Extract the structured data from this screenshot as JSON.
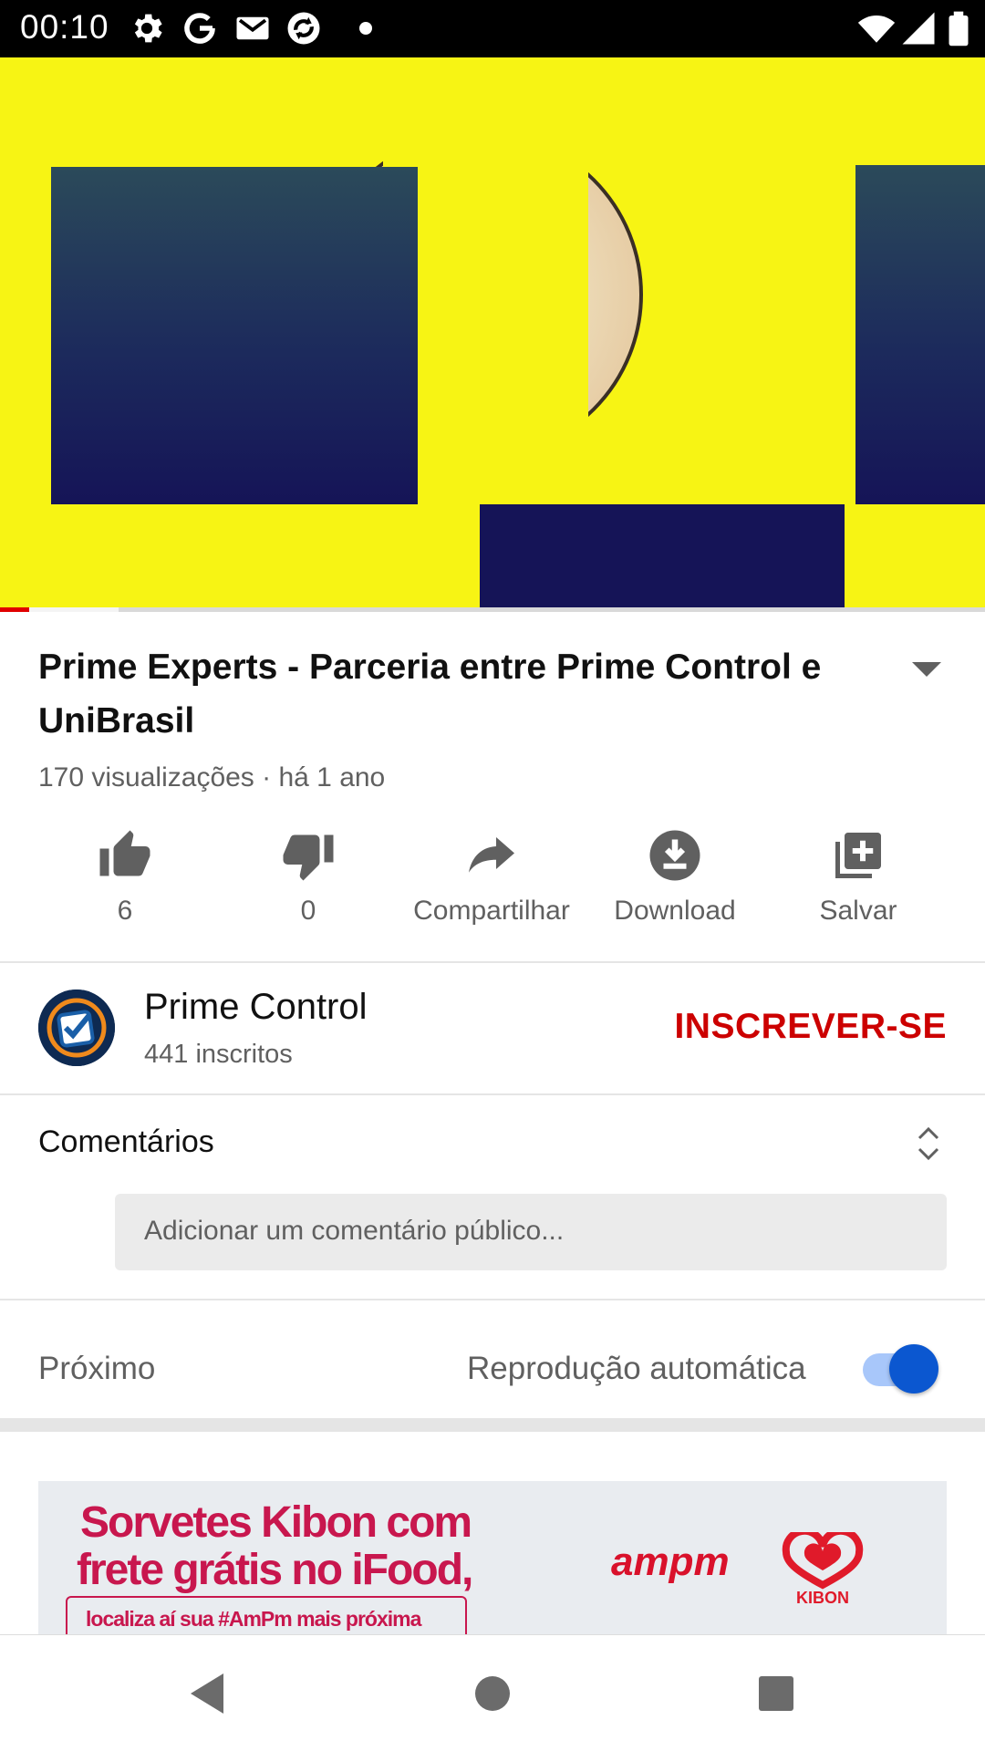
{
  "status_bar": {
    "time": "00:10",
    "icons": [
      "gear-icon",
      "google-icon",
      "gmail-icon",
      "sync-icon",
      "dot-icon",
      "wifi-icon",
      "signal-icon",
      "battery-icon"
    ]
  },
  "video": {
    "progress_fraction": 0.03,
    "buffer_fraction": 0.12
  },
  "details": {
    "title": "Prime Experts - Parceria entre Prime Control e UniBrasil",
    "meta": "170 visualizações · há 1 ano"
  },
  "actions": {
    "like_count": "6",
    "dislike_count": "0",
    "share_label": "Compartilhar",
    "download_label": "Download",
    "save_label": "Salvar"
  },
  "channel": {
    "name": "Prime Control",
    "subscribers": "441 inscritos",
    "subscribe_label": "INSCREVER-SE"
  },
  "comments": {
    "title": "Comentários",
    "placeholder": "Adicionar um comentário público..."
  },
  "up_next": {
    "label": "Próximo",
    "autoplay_label": "Reprodução automática",
    "autoplay_on": true
  },
  "ad": {
    "line1": "Sorvetes Kibon com",
    "line2": "frete grátis no iFood,",
    "line3": "localiza aí sua #AmPm mais próxima",
    "brand1": "ampm",
    "brand2": "KIBON"
  },
  "colors": {
    "accent_red": "#cc0000",
    "toggle_blue": "#0b57d0",
    "video_yellow": "#f7f414"
  }
}
